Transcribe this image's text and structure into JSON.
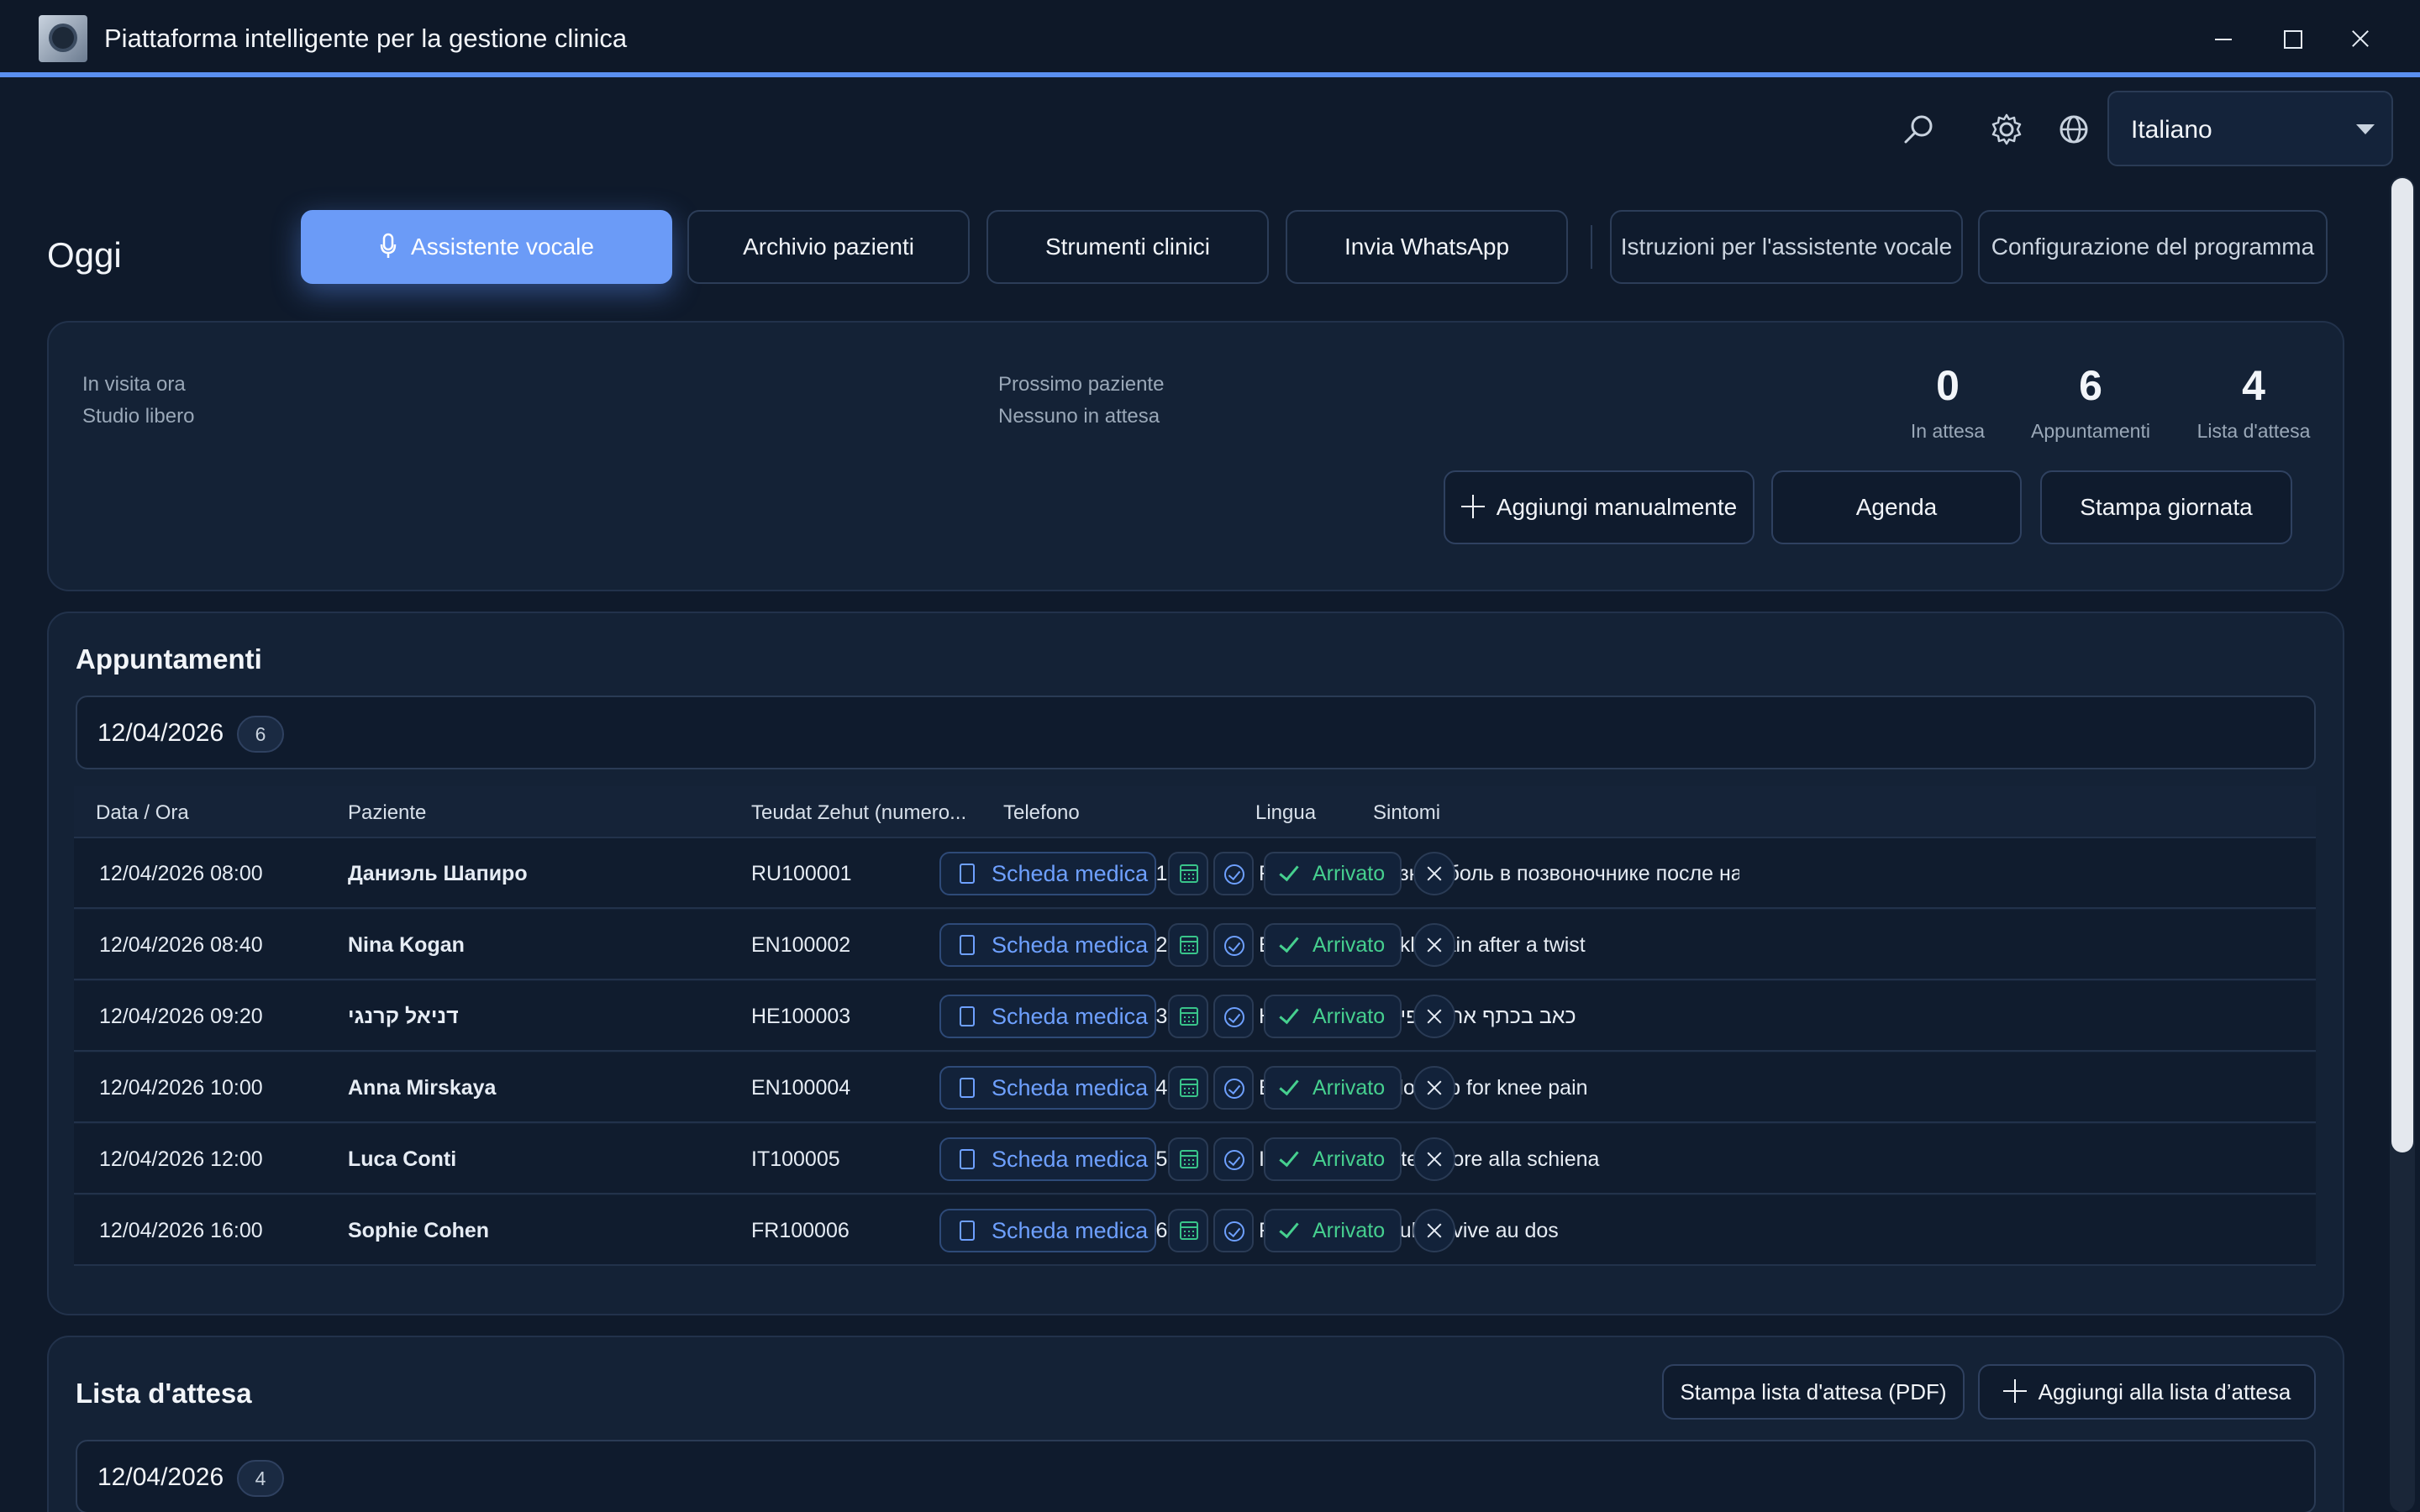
{
  "window": {
    "title": "Piattaforma intelligente per la gestione clinica"
  },
  "toolbar": {
    "language": "Italiano"
  },
  "page": {
    "title": "Oggi"
  },
  "nav": {
    "voice_assistant": "Assistente vocale",
    "patient_archive": "Archivio pazienti",
    "clinical_tools": "Strumenti clinici",
    "send_whatsapp": "Invia WhatsApp",
    "assistant_instructions": "Istruzioni per l'assistente vocale",
    "program_config": "Configurazione del programma"
  },
  "summary": {
    "in_visit_label": "In visita ora",
    "in_visit_value": "Studio libero",
    "next_patient_label": "Prossimo paziente",
    "next_patient_value": "Nessuno in attesa",
    "stats": [
      {
        "value": "0",
        "label": "In attesa"
      },
      {
        "value": "6",
        "label": "Appuntamenti"
      },
      {
        "value": "4",
        "label": "Lista d'attesa"
      }
    ],
    "add_manual": "Aggiungi manualmente",
    "agenda": "Agenda",
    "print_day": "Stampa giornata"
  },
  "appointments": {
    "title": "Appuntamenti",
    "date": "12/04/2026",
    "count": "6",
    "columns": [
      "Data / Ora",
      "Paziente",
      "Teudat Zehut (numero...",
      "Telefono",
      "Lingua",
      "Sintomi"
    ],
    "medical_record_label": "Scheda medica",
    "arrived_label": "Arrivato",
    "rows": [
      {
        "datetime": "12/04/2026 08:00",
        "patient": "Даниэль Шапиро",
        "id": "RU100001",
        "phone": "+9725599000201",
        "lang": "RU",
        "symptoms": "резкая боль в позвоночнике после нак"
      },
      {
        "datetime": "12/04/2026 08:40",
        "patient": "Nina Kogan",
        "id": "EN100002",
        "phone": "+9725599000202",
        "lang": "EN",
        "symptoms": "ankle pain after a twist"
      },
      {
        "datetime": "12/04/2026 09:20",
        "patient": "דניאל קרנגי",
        "id": "HE100003",
        "phone": "+9725599000203",
        "lang": "HE",
        "symptoms": "כאב בכתף אחרי נפילה"
      },
      {
        "datetime": "12/04/2026 10:00",
        "patient": "Anna Mirskaya",
        "id": "EN100004",
        "phone": "+9725599000204",
        "lang": "EN",
        "symptoms": "follow-up for knee pain"
      },
      {
        "datetime": "12/04/2026 12:00",
        "patient": "Luca Conti",
        "id": "IT100005",
        "phone": "+9725599000205",
        "lang": "IT",
        "symptoms": "forte dolore alla schiena"
      },
      {
        "datetime": "12/04/2026 16:00",
        "patient": "Sophie Cohen",
        "id": "FR100006",
        "phone": "+9725599000206",
        "lang": "FR",
        "symptoms": "douleur vive au dos"
      }
    ]
  },
  "waitlist": {
    "title": "Lista d'attesa",
    "print_pdf": "Stampa lista d'attesa (PDF)",
    "add": "Aggiungi alla lista d’attesa",
    "date": "12/04/2026",
    "count": "4"
  },
  "colors": {
    "accent": "#6b9bf7",
    "background": "#0f1a2b",
    "success": "#46d08f",
    "link": "#6ea0ff"
  }
}
